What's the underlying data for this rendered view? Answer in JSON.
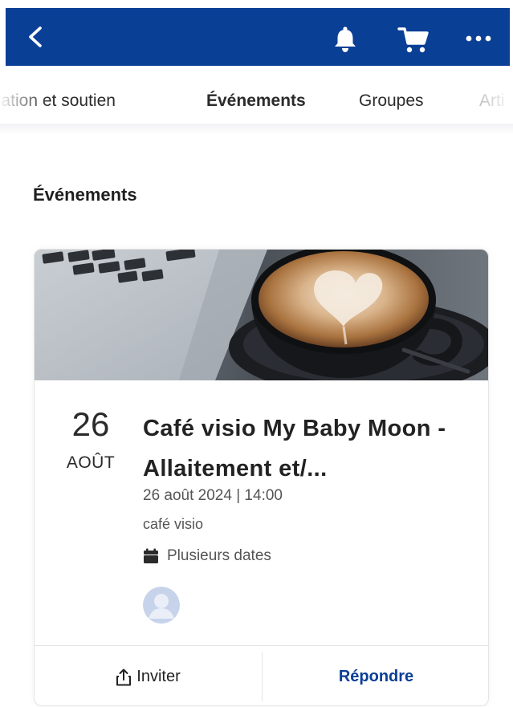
{
  "colors": {
    "brand": "#0a3f96",
    "text": "#1f1f1f",
    "muted": "#555555"
  },
  "appbar": {
    "back_icon": "chevron-left-icon",
    "notifications_icon": "bell-icon",
    "cart_icon": "cart-icon",
    "more_icon": "more-horizontal-icon"
  },
  "tabs": [
    {
      "label": "mation et soutien",
      "active": false
    },
    {
      "label": "Événements",
      "active": true
    },
    {
      "label": "Groupes",
      "active": false
    },
    {
      "label": "Arti",
      "active": false
    }
  ],
  "section": {
    "title": "Événements"
  },
  "event": {
    "day": "26",
    "month": "AOÛT",
    "title": "Café visio My Baby Moon -Allaitement et/...",
    "datetime": "26 août 2024 | 14:00",
    "location": "café visio",
    "dates_icon": "calendar-icon",
    "dates_label": "Plusieurs dates",
    "image": "coffee-cup-and-laptop-photo",
    "actions": {
      "invite_icon": "share-icon",
      "invite_label": "Inviter",
      "reply_label": "Répondre"
    }
  }
}
